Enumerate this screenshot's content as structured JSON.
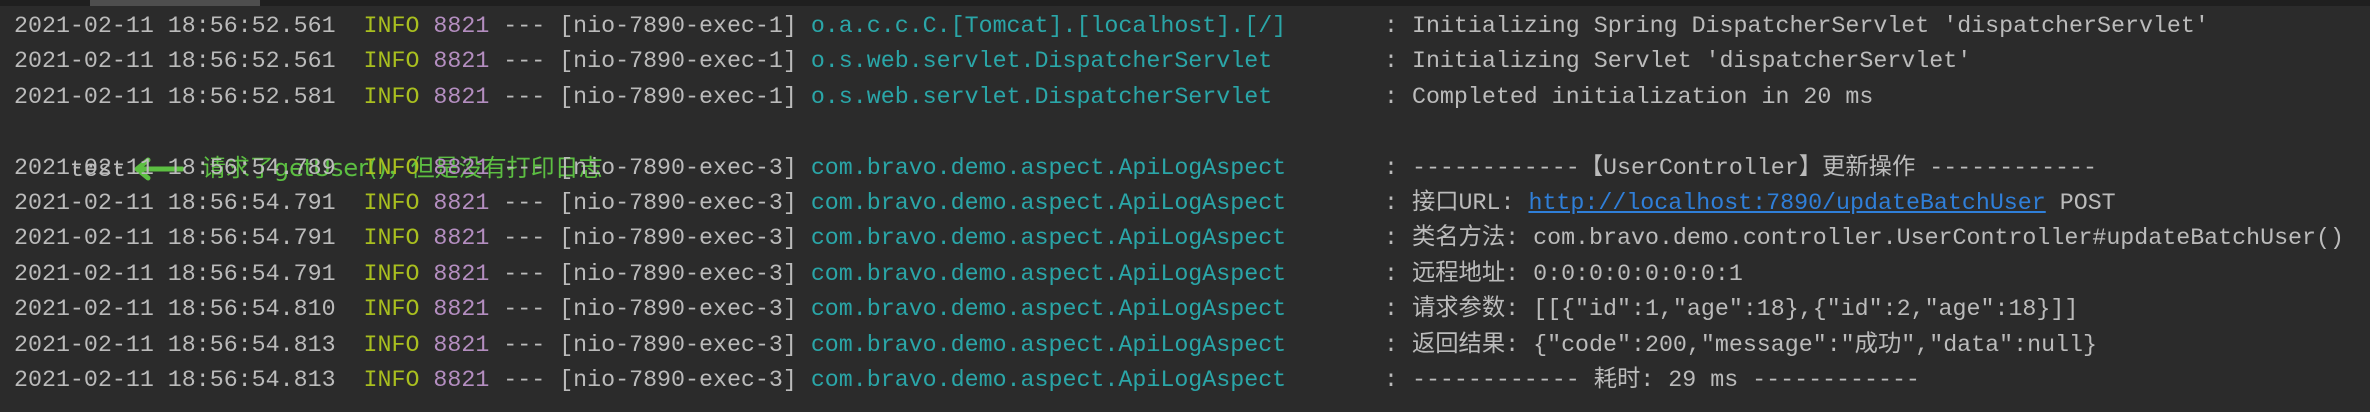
{
  "colors": {
    "background": "#2b2b2b",
    "text": "#bbbbbb",
    "level": "#a9bf1f",
    "pid": "#b48ec0",
    "logger": "#2aa6a8",
    "link": "#2f7fd9",
    "annotation": "#5cbf42"
  },
  "rows": [
    {
      "ts": "2021-02-11 18:56:52.561",
      "level": "INFO",
      "pid": "8821",
      "sep": "---",
      "thread": "[nio-7890-exec-1]",
      "logger": "o.a.c.c.C.[Tomcat].[localhost].[/]",
      "colon": ":",
      "msg": "Initializing Spring DispatcherServlet 'dispatcherServlet'"
    },
    {
      "ts": "2021-02-11 18:56:52.561",
      "level": "INFO",
      "pid": "8821",
      "sep": "---",
      "thread": "[nio-7890-exec-1]",
      "logger": "o.s.web.servlet.DispatcherServlet",
      "colon": ":",
      "msg": "Initializing Servlet 'dispatcherServlet'"
    },
    {
      "ts": "2021-02-11 18:56:52.581",
      "level": "INFO",
      "pid": "8821",
      "sep": "---",
      "thread": "[nio-7890-exec-1]",
      "logger": "o.s.web.servlet.DispatcherServlet",
      "colon": ":",
      "msg": "Completed initialization in 20 ms"
    }
  ],
  "test_line": {
    "text": "test",
    "icon": "arrow-left-icon",
    "annotation": "请求了getUser()，但是没有打印日志"
  },
  "rows2": [
    {
      "ts": "2021-02-11 18:56:54.789",
      "level": "INFO",
      "pid": "8821",
      "sep": "---",
      "thread": "[nio-7890-exec-3]",
      "logger": "com.bravo.demo.aspect.ApiLogAspect",
      "colon": ":",
      "msg": "------------【UserController】更新操作 ------------"
    },
    {
      "ts": "2021-02-11 18:56:54.791",
      "level": "INFO",
      "pid": "8821",
      "sep": "---",
      "thread": "[nio-7890-exec-3]",
      "logger": "com.bravo.demo.aspect.ApiLogAspect",
      "colon": ":",
      "msg": "接口URL: ",
      "link": "http://localhost:7890/updateBatchUser",
      "suffix": " POST"
    },
    {
      "ts": "2021-02-11 18:56:54.791",
      "level": "INFO",
      "pid": "8821",
      "sep": "---",
      "thread": "[nio-7890-exec-3]",
      "logger": "com.bravo.demo.aspect.ApiLogAspect",
      "colon": ":",
      "msg": "类名方法: com.bravo.demo.controller.UserController#updateBatchUser()"
    },
    {
      "ts": "2021-02-11 18:56:54.791",
      "level": "INFO",
      "pid": "8821",
      "sep": "---",
      "thread": "[nio-7890-exec-3]",
      "logger": "com.bravo.demo.aspect.ApiLogAspect",
      "colon": ":",
      "msg": "远程地址: 0:0:0:0:0:0:0:1"
    },
    {
      "ts": "2021-02-11 18:56:54.810",
      "level": "INFO",
      "pid": "8821",
      "sep": "---",
      "thread": "[nio-7890-exec-3]",
      "logger": "com.bravo.demo.aspect.ApiLogAspect",
      "colon": ":",
      "msg": "请求参数: [[{\"id\":1,\"age\":18},{\"id\":2,\"age\":18}]]"
    },
    {
      "ts": "2021-02-11 18:56:54.813",
      "level": "INFO",
      "pid": "8821",
      "sep": "---",
      "thread": "[nio-7890-exec-3]",
      "logger": "com.bravo.demo.aspect.ApiLogAspect",
      "colon": ":",
      "msg": "返回结果: {\"code\":200,\"message\":\"成功\",\"data\":null}"
    },
    {
      "ts": "2021-02-11 18:56:54.813",
      "level": "INFO",
      "pid": "8821",
      "sep": "---",
      "thread": "[nio-7890-exec-3]",
      "logger": "com.bravo.demo.aspect.ApiLogAspect",
      "colon": ":",
      "msg": "------------ 耗时: 29 ms ------------"
    }
  ]
}
